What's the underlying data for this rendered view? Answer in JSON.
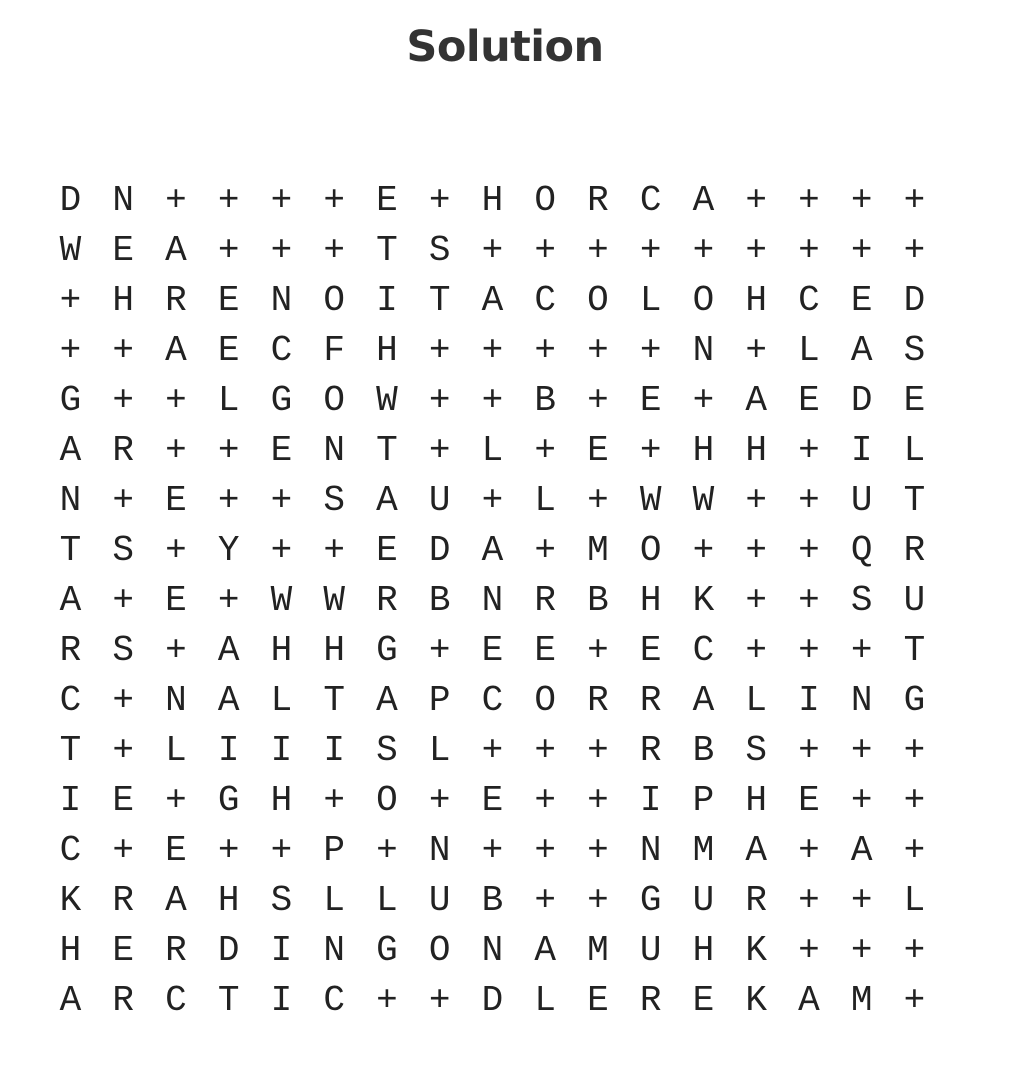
{
  "title": "Solution",
  "grid": [
    [
      "D",
      "N",
      "+",
      "+",
      "+",
      "+",
      "E",
      "+",
      "H",
      "O",
      "R",
      "C",
      "A",
      "+",
      "+",
      "+",
      "+"
    ],
    [
      "W",
      "E",
      "A",
      "+",
      "+",
      "+",
      "T",
      "S",
      "+",
      "+",
      "+",
      "+",
      "+",
      "+",
      "+",
      "+",
      "+"
    ],
    [
      "+",
      "H",
      "R",
      "E",
      "N",
      "O",
      "I",
      "T",
      "A",
      "C",
      "O",
      "L",
      "O",
      "H",
      "C",
      "E",
      "D"
    ],
    [
      "+",
      "+",
      "A",
      "E",
      "C",
      "F",
      "H",
      "+",
      "+",
      "+",
      "+",
      "+",
      "N",
      "+",
      "L",
      "A",
      "S"
    ],
    [
      "G",
      "+",
      "+",
      "L",
      "G",
      "O",
      "W",
      "+",
      "+",
      "B",
      "+",
      "E",
      "+",
      "A",
      "E",
      "D",
      "E"
    ],
    [
      "A",
      "R",
      "+",
      "+",
      "E",
      "N",
      "T",
      "+",
      "L",
      "+",
      "E",
      "+",
      "H",
      "H",
      "+",
      "I",
      "L"
    ],
    [
      "N",
      "+",
      "E",
      "+",
      "+",
      "S",
      "A",
      "U",
      "+",
      "L",
      "+",
      "W",
      "W",
      "+",
      "+",
      "U",
      "T"
    ],
    [
      "T",
      "S",
      "+",
      "Y",
      "+",
      "+",
      "E",
      "D",
      "A",
      "+",
      "M",
      "O",
      "+",
      "+",
      "+",
      "Q",
      "R"
    ],
    [
      "A",
      "+",
      "E",
      "+",
      "W",
      "W",
      "R",
      "B",
      "N",
      "R",
      "B",
      "H",
      "K",
      "+",
      "+",
      "S",
      "U"
    ],
    [
      "R",
      "S",
      "+",
      "A",
      "H",
      "H",
      "G",
      "+",
      "E",
      "E",
      "+",
      "E",
      "C",
      "+",
      "+",
      "+",
      "T"
    ],
    [
      "C",
      "+",
      "N",
      "A",
      "L",
      "T",
      "A",
      "P",
      "C",
      "O",
      "R",
      "R",
      "A",
      "L",
      "I",
      "N",
      "G"
    ],
    [
      "T",
      "+",
      "L",
      "I",
      "I",
      "I",
      "S",
      "L",
      "+",
      "+",
      "+",
      "R",
      "B",
      "S",
      "+",
      "+",
      "+"
    ],
    [
      "I",
      "E",
      "+",
      "G",
      "H",
      "+",
      "O",
      "+",
      "E",
      "+",
      "+",
      "I",
      "P",
      "H",
      "E",
      "+",
      "+"
    ],
    [
      "C",
      "+",
      "E",
      "+",
      "+",
      "P",
      "+",
      "N",
      "+",
      "+",
      "+",
      "N",
      "M",
      "A",
      "+",
      "A",
      "+"
    ],
    [
      "K",
      "R",
      "A",
      "H",
      "S",
      "L",
      "L",
      "U",
      "B",
      "+",
      "+",
      "G",
      "U",
      "R",
      "+",
      "+",
      "L"
    ],
    [
      "H",
      "E",
      "R",
      "D",
      "I",
      "N",
      "G",
      "O",
      "N",
      "A",
      "M",
      "U",
      "H",
      "K",
      "+",
      "+",
      "+"
    ],
    [
      "A",
      "R",
      "C",
      "T",
      "I",
      "C",
      "+",
      "+",
      "D",
      "L",
      "E",
      "R",
      "E",
      "K",
      "A",
      "M",
      "+"
    ]
  ]
}
